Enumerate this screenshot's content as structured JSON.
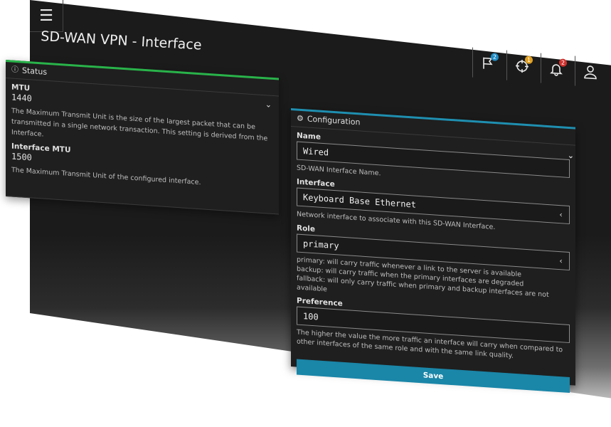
{
  "header": {
    "menu_icon": "hamburger-icon",
    "title": "SD-WAN VPN - Interface",
    "flag_count": "2",
    "target_count": "1",
    "bell_count": "2",
    "colors": {
      "flag_badge": "#1e8bc3",
      "target_badge": "#e0a020",
      "bell_badge": "#d0312d"
    }
  },
  "status": {
    "title": "Status",
    "icon": "info-icon",
    "mtu_label": "MTU",
    "mtu_value": "1440",
    "mtu_desc": "The Maximum Transmit Unit is the size of the largest packet that can be transmitted in a single network transaction. This setting is derived from the Interface.",
    "iface_mtu_label": "Interface MTU",
    "iface_mtu_value": "1500",
    "iface_mtu_desc": "The Maximum Transmit Unit of the configured interface.",
    "accent": "#29b34a"
  },
  "config": {
    "title": "Configuration",
    "icon": "gear-icon",
    "name_label": "Name",
    "name_value": "Wired",
    "name_desc": "SD-WAN Interface Name.",
    "interface_label": "Interface",
    "interface_value": "Keyboard Base Ethernet",
    "interface_desc": "Network interface to associate with this SD-WAN Interface.",
    "role_label": "Role",
    "role_value": "primary",
    "role_desc_1": "primary: will carry traffic whenever a link to the server is available",
    "role_desc_2": "backup: will carry traffic when the primary interfaces are degraded",
    "role_desc_3": "fallback: will only carry traffic when primary and backup interfaces are not available",
    "preference_label": "Preference",
    "preference_value": "100",
    "preference_desc": "The higher the value the more traffic an interface will carry when compared to other interfaces of the same role and with the same link quality.",
    "save_label": "Save",
    "accent": "#1f8fb0"
  }
}
